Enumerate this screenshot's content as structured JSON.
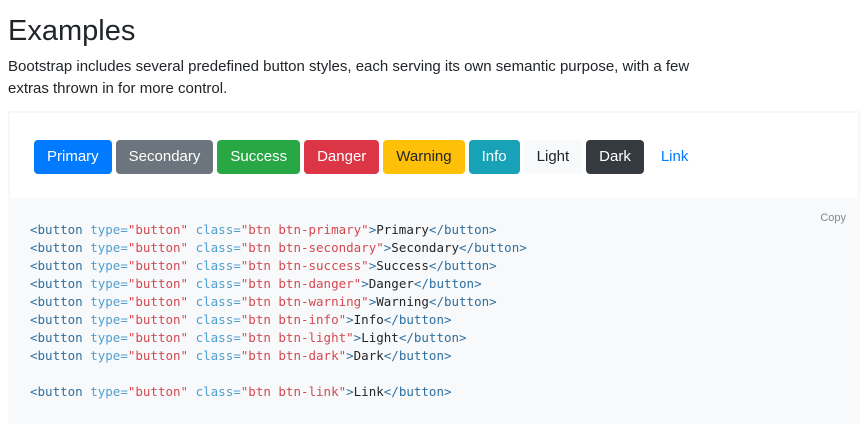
{
  "page": {
    "title": "Examples",
    "description": "Bootstrap includes several predefined button styles, each serving its own semantic purpose, with a few extras thrown in for more control."
  },
  "colors": {
    "primary": "#007bff",
    "secondary": "#6c757d",
    "success": "#28a745",
    "danger": "#dc3545",
    "warning": "#ffc107",
    "info": "#17a2b8",
    "light": "#f8f9fa",
    "dark": "#343a40",
    "code_tag": "#2f6f9f",
    "code_attr": "#4f9fcf",
    "code_value": "#d44950"
  },
  "buttons": [
    {
      "key": "primary",
      "label": "Primary"
    },
    {
      "key": "secondary",
      "label": "Secondary"
    },
    {
      "key": "success",
      "label": "Success"
    },
    {
      "key": "danger",
      "label": "Danger"
    },
    {
      "key": "warning",
      "label": "Warning"
    },
    {
      "key": "info",
      "label": "Info"
    },
    {
      "key": "light",
      "label": "Light"
    },
    {
      "key": "dark",
      "label": "Dark"
    },
    {
      "key": "link",
      "label": "Link"
    }
  ],
  "code": {
    "copy_label": "Copy",
    "tag_open": "<button",
    "attr_type": "type=",
    "value_type": "\"button\"",
    "attr_class": "class=",
    "tag_close": "</button>",
    "lines": [
      {
        "class_value": "\"btn btn-primary\"",
        "text": "Primary"
      },
      {
        "class_value": "\"btn btn-secondary\"",
        "text": "Secondary"
      },
      {
        "class_value": "\"btn btn-success\"",
        "text": "Success"
      },
      {
        "class_value": "\"btn btn-danger\"",
        "text": "Danger"
      },
      {
        "class_value": "\"btn btn-warning\"",
        "text": "Warning"
      },
      {
        "class_value": "\"btn btn-info\"",
        "text": "Info"
      },
      {
        "class_value": "\"btn btn-light\"",
        "text": "Light"
      },
      {
        "class_value": "\"btn btn-dark\"",
        "text": "Dark"
      },
      {
        "class_value": "\"btn btn-link\"",
        "text": "Link"
      }
    ]
  }
}
